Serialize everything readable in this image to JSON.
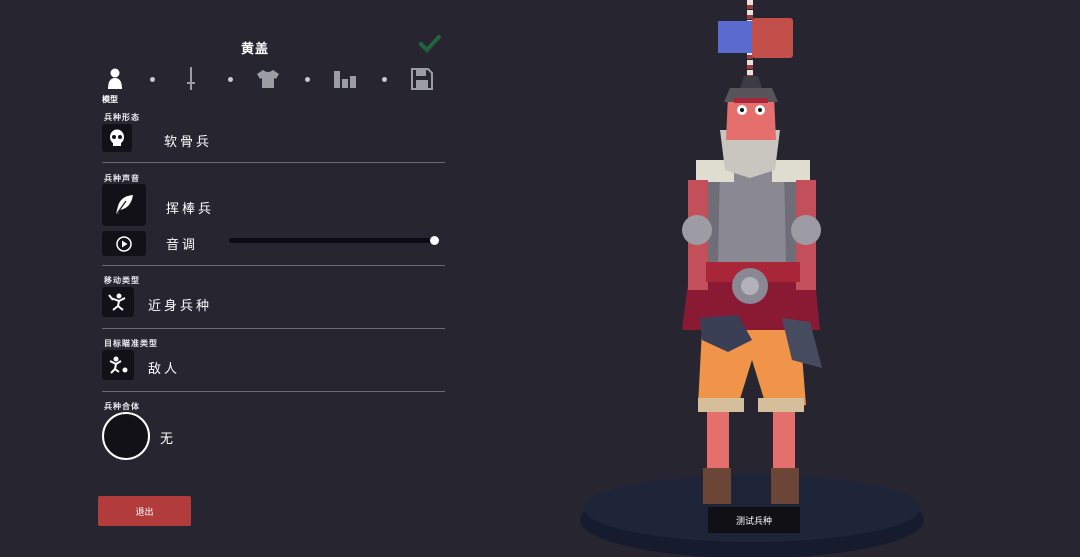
{
  "unit_name": "黄盖",
  "tabs": [
    {
      "id": "model",
      "label": "模型",
      "icon": "person-icon"
    },
    {
      "id": "weapon",
      "icon": "sword-icon"
    },
    {
      "id": "clothing",
      "icon": "shirt-icon"
    },
    {
      "id": "stats",
      "icon": "bar-chart-icon"
    },
    {
      "id": "save",
      "icon": "floppy-disk-icon"
    }
  ],
  "sections": {
    "unit_form": {
      "label": "兵种形态",
      "value": "软骨兵",
      "icon": "skull-icon"
    },
    "unit_sound": {
      "label": "兵种声音",
      "value": "挥棒兵",
      "icon": "feather-icon",
      "pitch_label": "音调",
      "pitch_level": 1.0
    },
    "movement": {
      "label": "移动类型",
      "value": "近身兵种",
      "icon": "melee-icon"
    },
    "targeting": {
      "label": "目标瞄准类型",
      "value": "敌人",
      "icon": "target-icon"
    },
    "merge": {
      "label": "兵种合体",
      "value": "无"
    }
  },
  "buttons": {
    "exit": "退出",
    "test_unit": "测试兵种"
  },
  "team_colors": {
    "blue": "#5a6bcf",
    "red": "#c24f4a"
  }
}
